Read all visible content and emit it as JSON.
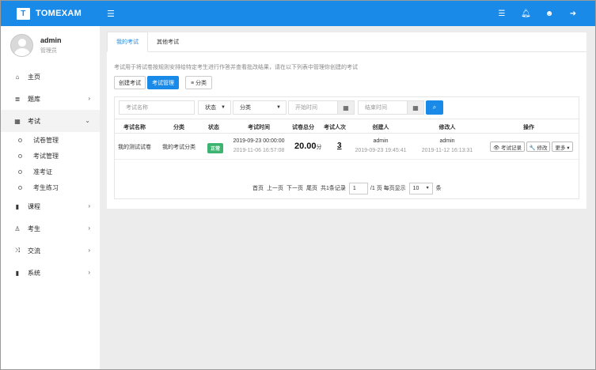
{
  "brand": {
    "logo": "T",
    "name": "TOMEXAM"
  },
  "topbar": {
    "icons": [
      "menu-icon",
      "list-icon",
      "bell-icon",
      "user-circle-icon",
      "logout-icon"
    ]
  },
  "user": {
    "name": "admin",
    "role": "管理员"
  },
  "nav": {
    "home": "主页",
    "question_bank": "题库",
    "exam": "考试",
    "exam_sub": [
      "试卷管理",
      "考试管理",
      "准考证",
      "考生练习"
    ],
    "course": "课程",
    "examinee": "考生",
    "exchange": "交流",
    "system": "系统"
  },
  "tabs": [
    "我的考试",
    "其他考试"
  ],
  "description": "考试用于将试卷按规则安排给特定考生进行作答并查看批改结果，请在以下列表中管理你创建的考试",
  "toolbar": {
    "create": "创建考试",
    "manage": "考试管理",
    "category": "≡ 分类"
  },
  "filters": {
    "name_placeholder": "考试名称",
    "status": "状态",
    "category": "分类",
    "start_placeholder": "开始时间",
    "end_placeholder": "结束时间"
  },
  "table": {
    "headers": [
      "考试名称",
      "分类",
      "状态",
      "考试时间",
      "试卷总分",
      "考试人次",
      "创建人",
      "修改人",
      "操作"
    ],
    "rows": [
      {
        "name": "我的测试试卷",
        "category": "我的考试分类",
        "status": "正常",
        "time_start": "2019-09-23 00:00:00",
        "time_end": "2019-11-06 16:57:08",
        "score": "20.00",
        "score_unit": "分",
        "count": "3",
        "creator": "admin",
        "created": "2019-09-23 19:45:41",
        "modifier": "admin",
        "modified": "2019-11-12 16:13:31",
        "actions": [
          "👁 考试记录",
          "🔧 修改",
          "更多 ▾"
        ]
      }
    ]
  },
  "pager": {
    "first": "首页",
    "prev": "上一页",
    "next": "下一页",
    "last": "尾页",
    "total": "共1条记录",
    "page_value": "1",
    "page_suffix": "/1 页 每页显示",
    "per_page": "10",
    "per_page_unit": "条"
  },
  "colors": {
    "primary": "#1a8ae8",
    "success": "#3cb371"
  }
}
